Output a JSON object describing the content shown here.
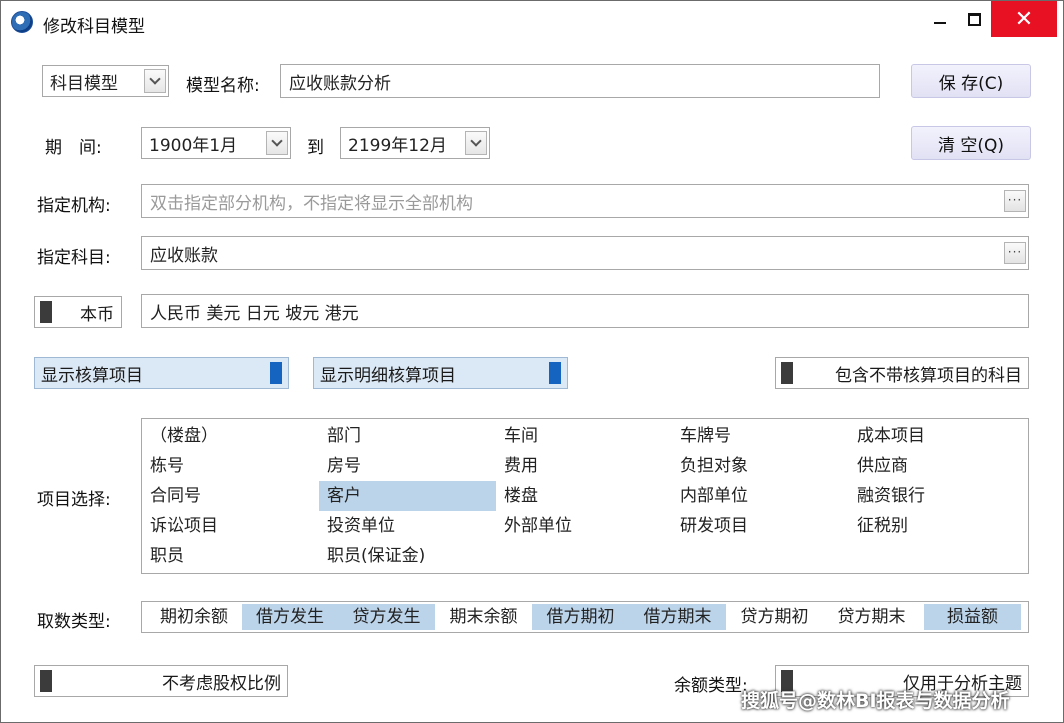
{
  "window": {
    "title": "修改科目模型",
    "controls": {
      "minimize": "minimize-icon",
      "maximize": "maximize-icon",
      "close": "✕"
    }
  },
  "header": {
    "model_type": "科目模型",
    "model_name_label": "模型名称:",
    "model_name_value": "应收账款分析",
    "save_label": "保 存(C)"
  },
  "period": {
    "label": "期　间:",
    "from": "1900年1月",
    "to_label": "到",
    "to": "2199年12月",
    "clear_label": "清 空(Q)"
  },
  "org": {
    "label": "指定机构:",
    "placeholder": "双击指定部分机构，不指定将显示全部机构"
  },
  "subject": {
    "label": "指定科目:",
    "value": "应收账款"
  },
  "currency": {
    "toggle_label": "本币",
    "value": "人民币  美元  日元  坡元  港元"
  },
  "toggles": {
    "show_items": "显示核算项目",
    "show_detail_items": "显示明细核算项目",
    "include_no_items": "包含不带核算项目的科目"
  },
  "item_select": {
    "label": "项目选择:",
    "columns": [
      [
        "（楼盘）",
        "栋号",
        "合同号",
        "诉讼项目",
        "职员"
      ],
      [
        "部门",
        "房号",
        "客户",
        "投资单位",
        "职员(保证金)"
      ],
      [
        "车间",
        "费用",
        "楼盘",
        "外部单位"
      ],
      [
        "车牌号",
        "负担对象",
        "内部单位",
        "研发项目"
      ],
      [
        "成本项目",
        "供应商",
        "融资银行",
        "征税别"
      ]
    ],
    "selected": "客户"
  },
  "fetch_type": {
    "label": "取数类型:",
    "options": [
      "期初余额",
      "借方发生",
      "贷方发生",
      "期末余额",
      "借方期初",
      "借方期末",
      "贷方期初",
      "贷方期末",
      "损益额"
    ],
    "selected": [
      "借方发生",
      "贷方发生",
      "借方期初",
      "借方期末",
      "损益额"
    ]
  },
  "footer": {
    "equity_toggle": "不考虑股权比例",
    "balance_type_label": "余额类型:",
    "balance_type_value": "仅用于分析主题"
  },
  "watermark": "搜狐号@数林BI报表与数据分析",
  "colors": {
    "selection": "#bcd4ea",
    "toggle_on": "#1565c0",
    "close_button": "#e81123"
  }
}
